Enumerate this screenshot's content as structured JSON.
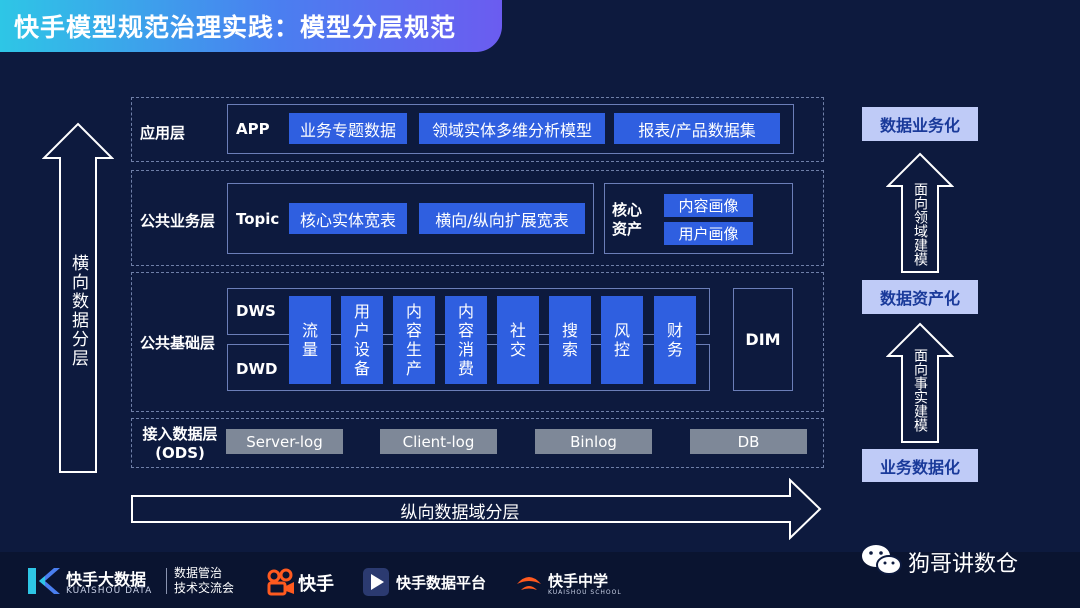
{
  "title": "快手模型规范治理实践：模型分层规范",
  "layers": {
    "app": {
      "label": "应用层",
      "sub_label": "APP",
      "items": [
        "业务专题数据",
        "领域实体多维分析模型",
        "报表/产品数据集"
      ]
    },
    "common_business": {
      "label": "公共业务层",
      "sub_label": "Topic",
      "items": [
        "核心实体宽表",
        "横向/纵向扩展宽表"
      ],
      "core_assets_label": "核心\n资产",
      "core_assets": [
        "内容画像",
        "用户画像"
      ]
    },
    "common_base": {
      "label": "公共基础层",
      "dws_label": "DWS",
      "dwd_label": "DWD",
      "domains": [
        "流\n量",
        "用\n户\n设\n备",
        "内\n容\n生\n产",
        "内\n容\n消\n费",
        "社\n交",
        "搜\n索",
        "风\n控",
        "财\n务"
      ],
      "dim_label": "DIM"
    },
    "ods": {
      "label": "接入数据层\n(ODS)",
      "sources": [
        "Server-log",
        "Client-log",
        "Binlog",
        "DB"
      ]
    }
  },
  "left_arrow_label": "横向数据分层",
  "bottom_arrow_label": "纵向数据域分层",
  "right_column": {
    "top": "数据业务化",
    "middle": "数据资产化",
    "bottom": "业务数据化",
    "upper_arrow_label": "面向领域建模",
    "lower_arrow_label": "面向事实建模"
  },
  "footer": {
    "brand": "快手大数据",
    "brand_sub": "KUAISHOU DATA",
    "brand_desc": "数据管治\n技术交流会",
    "kuaishou": "快手",
    "data_platform": "快手数据平台",
    "school": "快手中学",
    "school_sub": "KUAISHOU SCHOOL",
    "wechat": "狗哥讲数仓"
  },
  "colors": {
    "background": "#0d1a3e",
    "box_blue": "#2f5fe0",
    "box_gray": "#7e8898",
    "box_light": "#bfcbf7",
    "accent_orange": "#ff5a1f"
  },
  "icons": {
    "kuaishou_logo": "kuaishou-logo-icon",
    "data_platform_logo": "play-triangle-icon",
    "school_logo": "flame-icon",
    "wechat_logo": "wechat-icon"
  }
}
